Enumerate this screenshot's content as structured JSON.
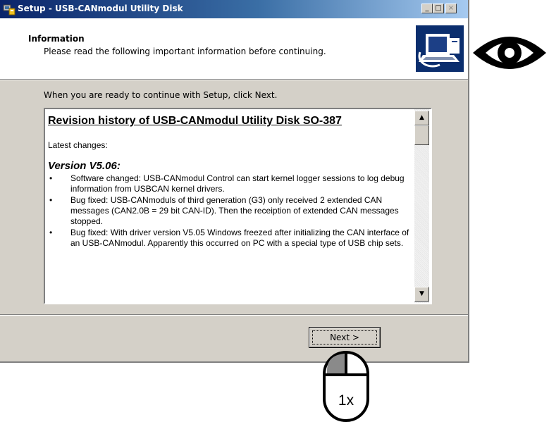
{
  "window": {
    "title": "Setup - USB-CANmodul Utility Disk",
    "controls": {
      "minimize": "_",
      "maximize": "□",
      "close": "×"
    }
  },
  "header": {
    "title": "Information",
    "subtitle": "Please read the following important information before continuing."
  },
  "body": {
    "intro": "When you are ready to continue with Setup, click Next."
  },
  "document": {
    "title": "Revision history of USB-CANmodul Utility Disk SO-387",
    "latest_label": "Latest changes:",
    "version": "Version V5.06:",
    "bullet": "•",
    "changes": [
      "Software changed: USB-CANmodul Control can start kernel logger sessions to log debug information from USBCAN kernel drivers.",
      "Bug fixed: USB-CANmoduls of third generation (G3) only received 2 extended CAN messages (CAN2.0B = 29 bit CAN-ID). Then the receiption of extended CAN messages stopped.",
      "Bug fixed: With driver version V5.05 Windows freezed after initializing the CAN interface of an USB-CANmodul. Apparently this occurred on PC with a special type of USB chip sets."
    ]
  },
  "scrollbar": {
    "up": "▲",
    "down": "▼"
  },
  "buttons": {
    "next": "Next >"
  },
  "overlay": {
    "click_count": "1x",
    "icons": [
      "eye-icon",
      "mouse-icon",
      "app-icon",
      "computer-logo-icon"
    ]
  },
  "colors": {
    "titlebar_start": "#0a246a",
    "titlebar_end": "#a6caf0",
    "dialog_bg": "#d4d0c8",
    "logo_bg": "#0b2e6e"
  }
}
